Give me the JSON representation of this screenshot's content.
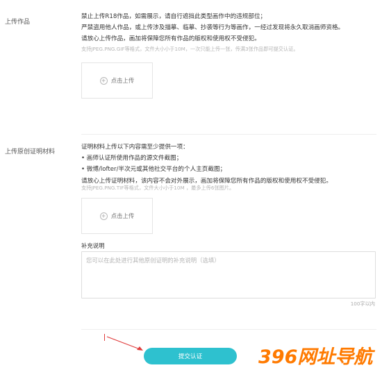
{
  "section1": {
    "label": "上传作品",
    "lines": [
      "禁止上传R18作品，如需展示，请自行遮挡此类型画作中的违规部位；",
      "严禁盗用他人作品，或上传涉及描摹、临摹、抄袭等行为等画作，一经过发现将永久取消画师资格。",
      "请放心上传作品，画加将保障您所有作品的版权和使用权不受侵犯。"
    ],
    "hint": "支持JPEG.PNG.GIF等格式，文件大小小于10M，一次只能上传一张，传满3张作品即可提交认证。",
    "upload_label": "点击上传"
  },
  "section2": {
    "label": "上传原创证明材料",
    "lines": [
      "证明材料上传以下内容需至少提供一项：",
      "• 画师认证所使用作品的源文件截图；",
      "• 微博/lofter/半次元或其他社交平台的个人主页截图；",
      "请放心上传证明材料，该内容不会对外展示，画加将保障您所有作品的版权和使用权不受侵犯。"
    ],
    "hint": "支持JPEG.PNG.TIF等格式，文件大小小于10M ，最多上传6张图片。",
    "upload_label": "点击上传",
    "supplement_label": "补充说明",
    "supplement_placeholder": "您可以在此处进行其他原创证明的补充说明（选填）",
    "counter": "100字以内"
  },
  "submit_label": "提交认证",
  "watermark": "396网址导航",
  "colors": {
    "accent": "#2ec1cf",
    "watermark": "#ff7a00",
    "arrow": "#e03b3b"
  }
}
